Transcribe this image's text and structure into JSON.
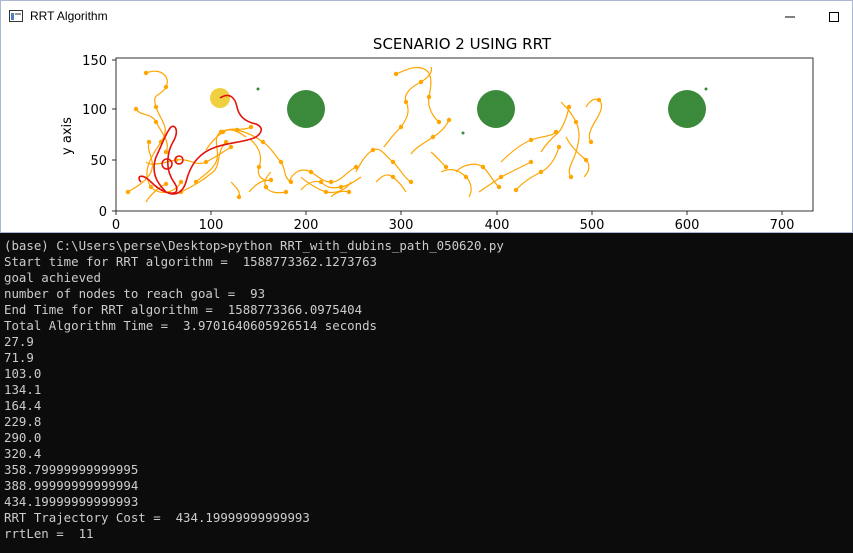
{
  "window": {
    "title": "RRT Algorithm"
  },
  "plot": {
    "title": "SCENARIO 2 USING RRT",
    "ylabel": "y axis",
    "xticks": [
      "0",
      "100",
      "200",
      "300",
      "400",
      "500",
      "600",
      "700"
    ],
    "yticks": [
      "0",
      "50",
      "100",
      "150"
    ],
    "colors": {
      "tree": "#ffa500",
      "path": "#e3120b",
      "obstacle": "#3b8a3b",
      "start": "#f0d040"
    }
  },
  "console": {
    "lines": [
      "(base) C:\\Users\\perse\\Desktop>python RRT_with_dubins_path_050620.py",
      "Start time for RRT algorithm =  1588773362.1273763",
      "goal achieved",
      "number of nodes to reach goal =  93",
      "End Time for RRT algorithm =  1588773366.0975404",
      "Total Algorithm Time =  3.9701640605926514 seconds",
      "27.9",
      "71.9",
      "103.0",
      "134.1",
      "164.4",
      "229.8",
      "290.0",
      "320.4",
      "358.79999999999995",
      "388.99999999999994",
      "434.19999999999993",
      "RRT Trajectory Cost =  434.19999999999993",
      "rrtLen =  11"
    ]
  }
}
